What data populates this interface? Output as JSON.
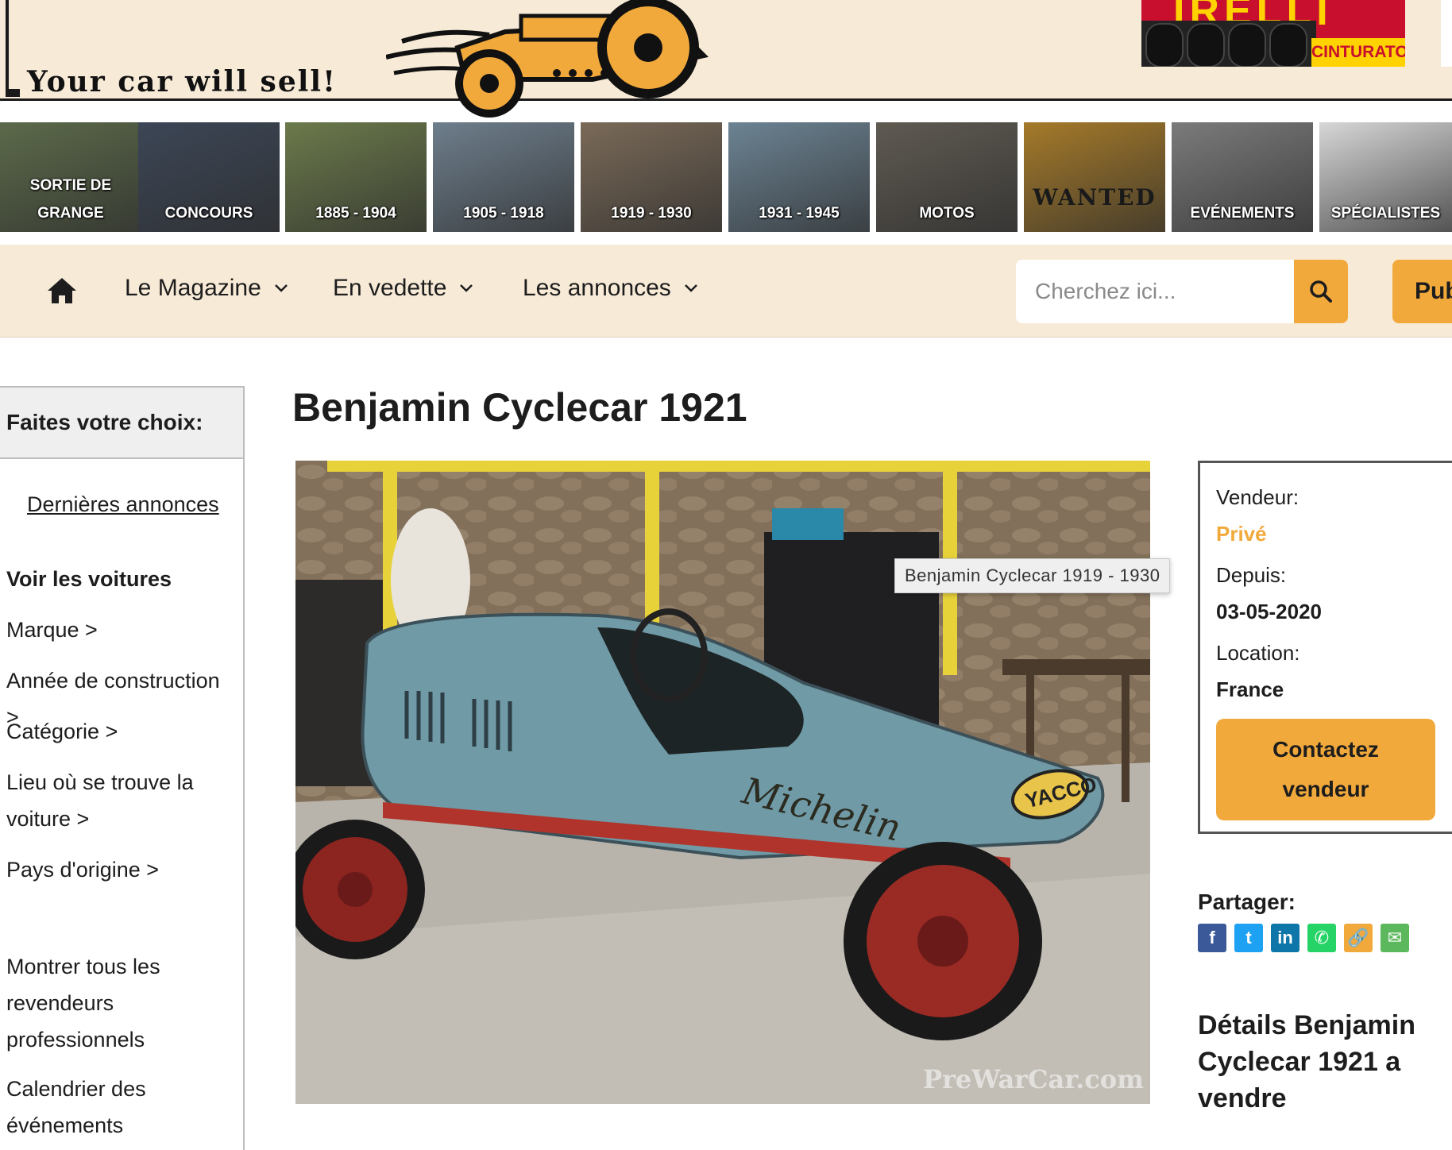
{
  "banner": {
    "tagline": "Your car will sell!",
    "ad": {
      "brand": "IRELLI",
      "sub": "CINTURATO"
    }
  },
  "categories": [
    {
      "label": "SORTIE DE GRANGE",
      "color": "#5c6a4a"
    },
    {
      "label": "CONCOURS",
      "color": "#3c4656"
    },
    {
      "label": "1885 - 1904",
      "color": "#6b7a4b"
    },
    {
      "label": "1905 - 1918",
      "color": "#6e7e8c"
    },
    {
      "label": "1919 - 1930",
      "color": "#7a6a58"
    },
    {
      "label": "1931 - 1945",
      "color": "#6c8393"
    },
    {
      "label": "MOTOS",
      "color": "#5f5a52"
    },
    {
      "label": "WANTED",
      "color": "#a57a2a"
    },
    {
      "label": "EVÉNEMENTS",
      "color": "#7b7b7b"
    },
    {
      "label": "SPÉCIALISTES",
      "color": "#d7d7d7"
    }
  ],
  "nav": {
    "items": [
      "Le Magazine",
      "En vedette",
      "Les annonces"
    ],
    "search_placeholder": "Cherchez ici...",
    "publish_label": "Pub"
  },
  "sidebar": {
    "heading": "Faites votre choix:",
    "latest": "Dernières annonces",
    "section_title": "Voir les voitures",
    "links": [
      "Marque >",
      "Année de construction >",
      "Catégorie >",
      "Lieu où se trouve la voiture >",
      "Pays d'origine >",
      "Montrer tous les revendeurs professionnels",
      "Calendrier des événements"
    ]
  },
  "listing": {
    "title": "Benjamin Cyclecar 1921",
    "tooltip": "Benjamin Cyclecar 1919 - 1930",
    "watermark": "PreWarCar.com",
    "decals": {
      "brand": "Michelin",
      "badge": "YACCO"
    }
  },
  "seller": {
    "seller_label": "Vendeur:",
    "seller_value": "Privé",
    "since_label": "Depuis:",
    "since_value": "03-05-2020",
    "location_label": "Location:",
    "location_value": "France",
    "contact_line1": "Contactez",
    "contact_line2": "vendeur"
  },
  "share": {
    "title": "Partager:",
    "buttons": [
      {
        "name": "facebook",
        "glyph": "f",
        "color": "#3b5998"
      },
      {
        "name": "twitter",
        "glyph": "t",
        "color": "#1da1f2"
      },
      {
        "name": "linkedin",
        "glyph": "in",
        "color": "#0e76a8"
      },
      {
        "name": "whatsapp",
        "glyph": "✆",
        "color": "#25d366"
      },
      {
        "name": "copy-link",
        "glyph": "🔗",
        "color": "#f2a93b"
      },
      {
        "name": "email",
        "glyph": "✉",
        "color": "#5cb85c"
      }
    ]
  },
  "details_title": "Détails Benjamin Cyclecar 1921 a vendre",
  "colors": {
    "accent": "#f2a93b",
    "banner_bg": "#f7ead7"
  }
}
